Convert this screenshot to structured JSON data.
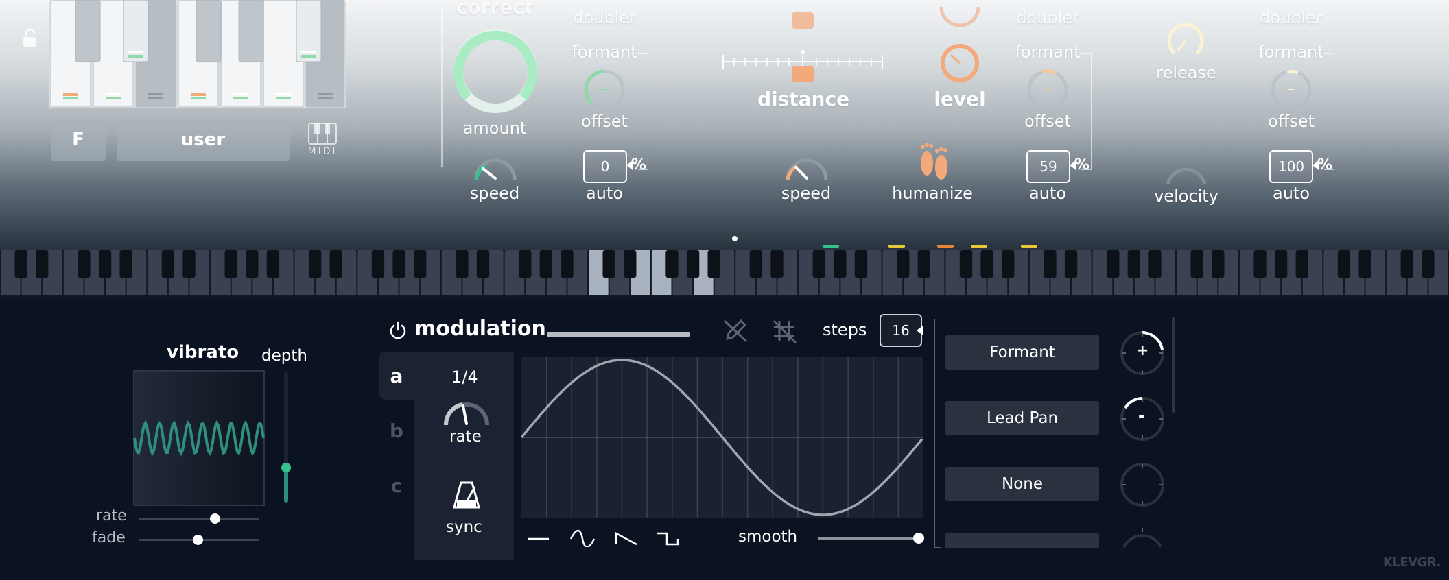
{
  "top": {
    "correct_title": "correct",
    "key_button": "F",
    "scale_button": "user",
    "midi_label": "MIDI",
    "amount_label": "amount",
    "speed_label_1": "speed",
    "doubler_1": "doubler",
    "formant_1": "formant",
    "offset_1": "offset",
    "auto_value_1": "0",
    "auto_label_1": "auto",
    "percent_1": "%",
    "distance_label": "distance",
    "speed_label_2": "speed",
    "level_label": "level",
    "humanize_label": "humanize",
    "doubler_2": "doubler",
    "formant_2": "formant",
    "offset_2": "offset",
    "auto_value_2": "59",
    "auto_label_2": "auto",
    "percent_2": "%",
    "release_label": "release",
    "velocity_label": "velocity",
    "doubler_3": "doubler",
    "formant_3": "formant",
    "offset_3": "offset",
    "auto_value_3": "100",
    "auto_label_3": "auto",
    "percent_3": "%"
  },
  "vibrato": {
    "title": "vibrato",
    "depth_label": "depth",
    "rate_label": "rate",
    "fade_label": "fade",
    "depth_level": 0.27,
    "rate_level": 0.63,
    "fade_level": 0.49,
    "wave_color": "#2f8f7e"
  },
  "modulation": {
    "title": "modulation",
    "steps_label": "steps",
    "steps_value": "16",
    "tabs": [
      "a",
      "b",
      "c"
    ],
    "active_tab": "a",
    "rate_value": "1/4",
    "rate_label": "rate",
    "sync_label": "sync",
    "smooth_label": "smooth",
    "smooth_level": 1.0,
    "shapes": [
      "flat-icon",
      "sine-icon",
      "saw-icon",
      "square-icon"
    ],
    "targets": [
      {
        "label": "Formant",
        "dial_sign": "+"
      },
      {
        "label": "Lead Pan",
        "dial_sign": "-"
      },
      {
        "label": "None",
        "dial_sign": ""
      }
    ]
  },
  "brand": "KLEVGR.",
  "colors": {
    "accent_green": "#34c28e",
    "accent_orange": "#f3a979",
    "led_yellow": "#e8c63a",
    "led_orange": "#e7873c",
    "panel_bg": "#0b1322"
  }
}
